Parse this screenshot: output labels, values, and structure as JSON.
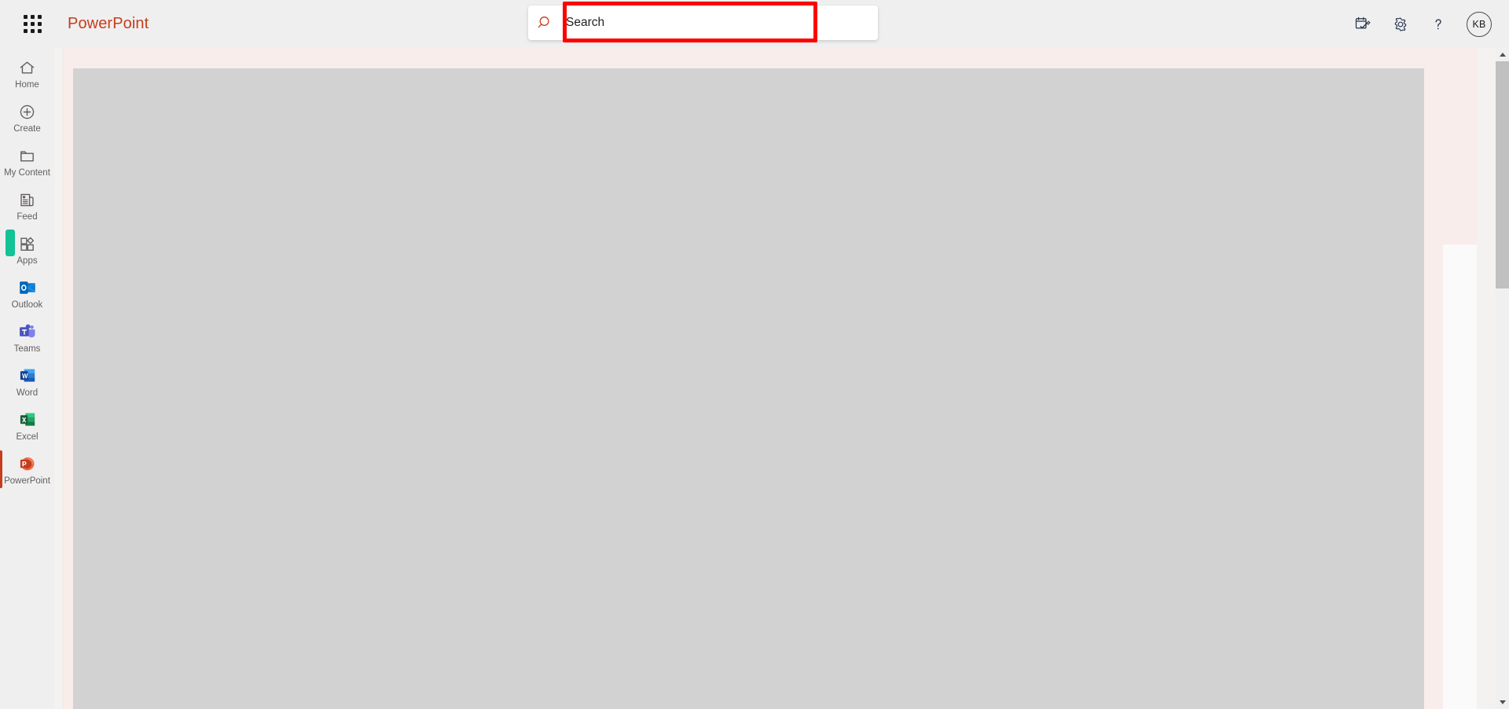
{
  "header": {
    "waffle_name": "app-launcher",
    "brand": "PowerPoint",
    "brand_color": "#c43e1c",
    "actions": [
      {
        "name": "tasks-icon",
        "label": "Tasks"
      },
      {
        "name": "settings-gear-icon",
        "label": "Settings"
      },
      {
        "name": "help-question-icon",
        "label": "Help"
      }
    ],
    "avatar": {
      "initials": "KB",
      "name": "account-avatar"
    }
  },
  "search": {
    "placeholder": "Search",
    "value": "",
    "icon": "search-icon",
    "icon_color": "#c43e1c",
    "highlighted": true,
    "highlight_color": "#ff0000"
  },
  "sidebar": {
    "items": [
      {
        "label": "Home",
        "icon": "home-icon",
        "selected": false
      },
      {
        "label": "Create",
        "icon": "create-plus-icon",
        "selected": false
      },
      {
        "label": "My Content",
        "icon": "folder-icon",
        "selected": false
      },
      {
        "label": "Feed",
        "icon": "feed-icon",
        "selected": false
      },
      {
        "label": "Apps",
        "icon": "apps-grid-icon",
        "selected": false
      },
      {
        "label": "Outlook",
        "icon": "outlook-icon",
        "selected": false
      },
      {
        "label": "Teams",
        "icon": "teams-icon",
        "selected": false
      },
      {
        "label": "Word",
        "icon": "word-icon",
        "selected": false
      },
      {
        "label": "Excel",
        "icon": "excel-icon",
        "selected": false
      },
      {
        "label": "PowerPoint",
        "icon": "powerpoint-icon",
        "selected": true
      }
    ],
    "selection_color": "#c43e1c"
  },
  "main": {
    "panel_background": "#f8edea",
    "placeholder_background": "#d2d2d2"
  },
  "scrollbar": {
    "track_color": "#f0f0f0",
    "thumb_color": "#c0c0c0",
    "marker_color": "#13c296"
  }
}
